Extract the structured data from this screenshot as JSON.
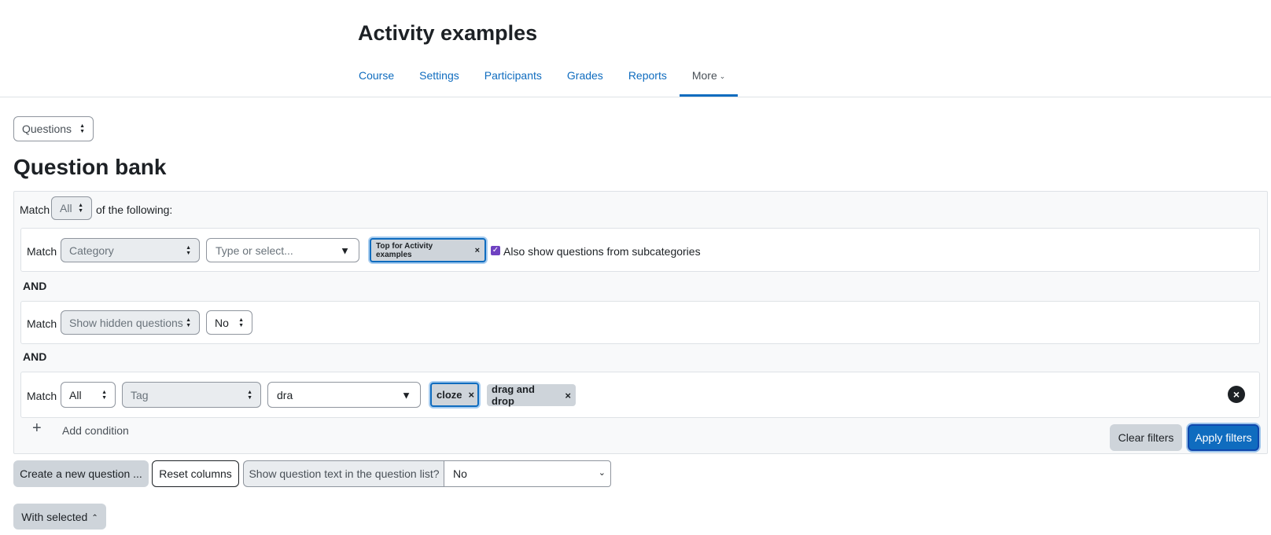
{
  "header": {
    "course_title": "Activity examples",
    "nav": [
      "Course",
      "Settings",
      "Participants",
      "Grades",
      "Reports"
    ],
    "more_label": "More"
  },
  "questions_select": "Questions",
  "page_title": "Question bank",
  "filters": {
    "match_label": "Match",
    "join_value": "All",
    "of_following": "of the following:",
    "and_label": "AND",
    "row1": {
      "field": "Category",
      "placeholder": "Type or select...",
      "chip": "Top for Activity examples",
      "checkbox_label": "Also show questions from subcategories"
    },
    "row2": {
      "field": "Show hidden questions",
      "value": "No"
    },
    "row3": {
      "join": "All",
      "field": "Tag",
      "input_value": "dra",
      "chips": [
        "cloze",
        "drag and drop"
      ]
    },
    "add_condition": "Add condition",
    "clear_filters": "Clear filters",
    "apply_filters": "Apply filters"
  },
  "toolbar": {
    "create_new": "Create a new question ...",
    "reset_columns": "Reset columns",
    "show_text_label": "Show question text in the question list?",
    "show_text_value": "No"
  },
  "with_selected": "With selected"
}
